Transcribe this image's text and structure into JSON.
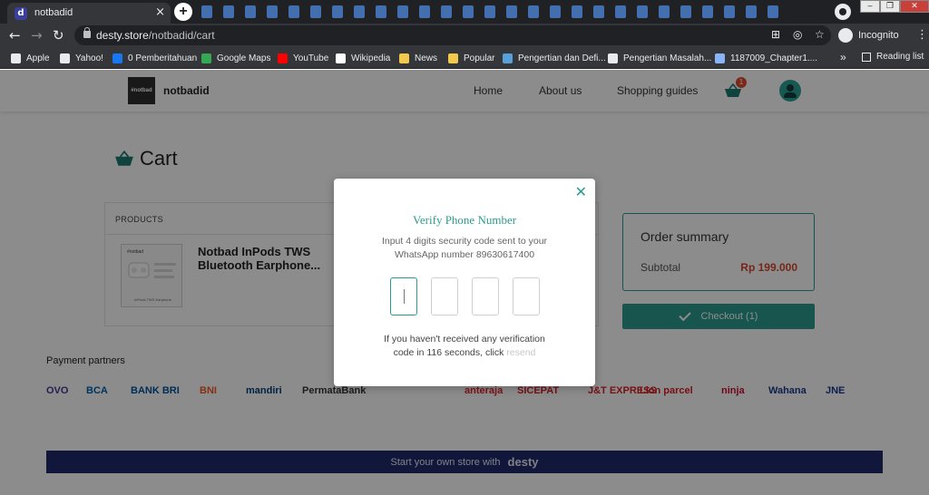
{
  "browser": {
    "tab_title": "notbadid",
    "tab_favicon": "d",
    "url_host": "desty.store",
    "url_path": "/notbadid/cart",
    "incognito_label": "Incognito",
    "reading_list": "Reading list",
    "more_bookmarks": "»",
    "bookmarks": [
      {
        "label": "Apple",
        "icon": "apple-icon",
        "color": "#e8eaed"
      },
      {
        "label": "Yahoo!",
        "icon": "globe-icon",
        "color": "#e8eaed"
      },
      {
        "label": "0 Pemberitahuan",
        "icon": "facebook-icon",
        "color": "#1877f2"
      },
      {
        "label": "Google Maps",
        "icon": "maps-icon",
        "color": "#34a853"
      },
      {
        "label": "YouTube",
        "icon": "youtube-icon",
        "color": "#ff0000"
      },
      {
        "label": "Wikipedia",
        "icon": "wikipedia-icon",
        "color": "#ffffff"
      },
      {
        "label": "News",
        "icon": "folder-icon",
        "color": "#f2c94c"
      },
      {
        "label": "Popular",
        "icon": "folder-icon",
        "color": "#f2c94c"
      },
      {
        "label": "Pengertian dan Defi...",
        "icon": "wordpress-icon",
        "color": "#5aa0d8"
      },
      {
        "label": "Pengertian Masalah...",
        "icon": "globe-icon",
        "color": "#e8eaed"
      },
      {
        "label": "1187009_Chapter1....",
        "icon": "file-icon",
        "color": "#8ab4f8"
      }
    ]
  },
  "header": {
    "logo_text": "#notbad",
    "store_name": "notbadid",
    "nav": [
      "Home",
      "About us",
      "Shopping guides"
    ],
    "cart_count": "1"
  },
  "cart": {
    "title": "Cart",
    "products_header": "PRODUCTS",
    "product_name": "Notbad InPods TWS Bluetooth Earphone...",
    "thumb_brand": "#notbad",
    "thumb_caption": "InPods TWS Earphone",
    "order_summary_title": "Order summary",
    "subtotal_label": "Subtotal",
    "subtotal_value": "Rp 199.000",
    "checkout_label": "Checkout (1)"
  },
  "partners": {
    "title": "Payment partners",
    "logos": [
      {
        "label": "OVO",
        "color": "#4c3494"
      },
      {
        "label": "BCA",
        "color": "#0060af"
      },
      {
        "label": "BANK BRI",
        "color": "#00529c"
      },
      {
        "label": "BNI",
        "color": "#f15a23"
      },
      {
        "label": "mandiri",
        "color": "#003d79"
      },
      {
        "label": "PermataBank",
        "color": "#333333"
      },
      {
        "label": "anteraja",
        "color": "#e3262d"
      },
      {
        "label": "SICEPAT",
        "color": "#d71f26"
      },
      {
        "label": "J&T EXPRESS",
        "color": "#d71f26"
      },
      {
        "label": "Lion parcel",
        "color": "#d71f26"
      },
      {
        "label": "ninja",
        "color": "#c8102e"
      },
      {
        "label": "Wahana",
        "color": "#1b3a8c"
      },
      {
        "label": "JNE",
        "color": "#1b3a8c"
      }
    ]
  },
  "banner": {
    "text": "Start your own store with",
    "brand": "desty"
  },
  "modal": {
    "title": "Verify Phone Number",
    "desc_line1": "Input 4 digits security code sent to your",
    "desc_line2": "WhatsApp number 89630617400",
    "code_digits": [
      "",
      "",
      "",
      ""
    ],
    "note_line1": "If you haven't received any verification",
    "note_line2": "code in 116 seconds, click",
    "resend_label": "resend",
    "accent_color": "#2a9c8f"
  }
}
